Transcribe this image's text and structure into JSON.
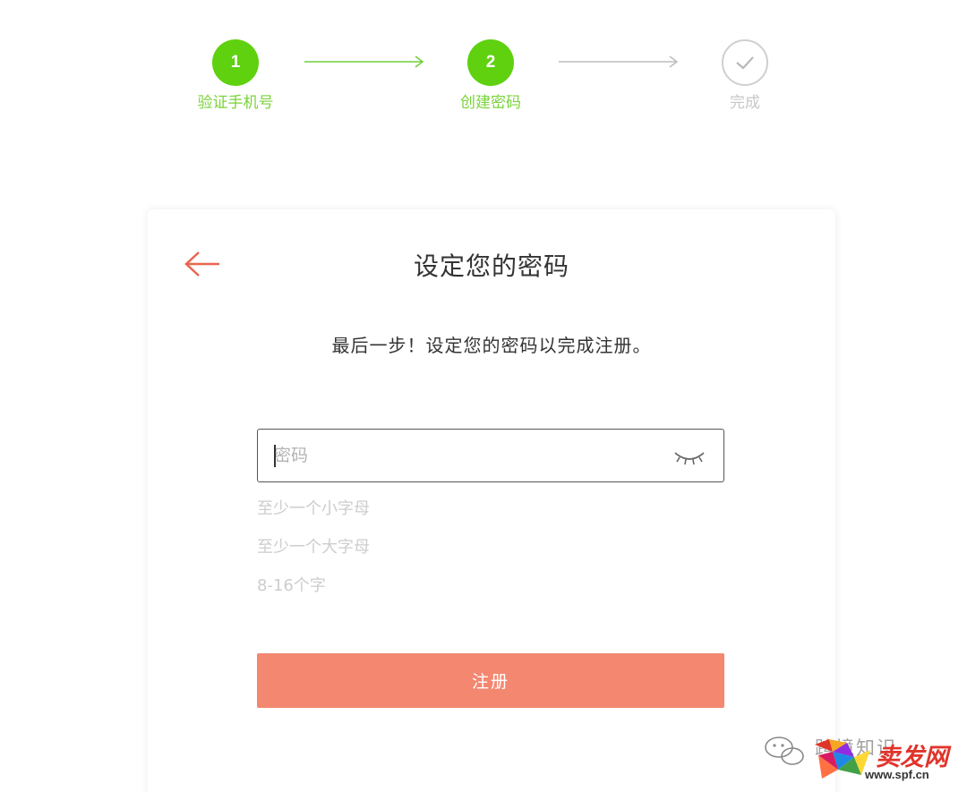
{
  "stepper": {
    "steps": [
      {
        "number": "1",
        "label": "验证手机号",
        "state": "completed"
      },
      {
        "number": "2",
        "label": "创建密码",
        "state": "current"
      },
      {
        "number": "",
        "label": "完成",
        "state": "pending"
      }
    ],
    "colors": {
      "active": "#5fd10f",
      "active_label": "#7ad33a",
      "pending": "#cfcfcf"
    }
  },
  "card": {
    "title": "设定您的密码",
    "subtitle": "最后一步！设定您的密码以完成注册。",
    "password": {
      "value": "",
      "placeholder": "密码",
      "visibility_icon": "eye-closed-icon"
    },
    "rules": [
      "至少一个小字母",
      "至少一个大字母",
      "8-16个字"
    ],
    "submit_label": "注册",
    "accent_color": "#f38770"
  },
  "watermark": {
    "caption": "跨境知识",
    "brand": "卖发网",
    "url": "www.spf.cn"
  }
}
